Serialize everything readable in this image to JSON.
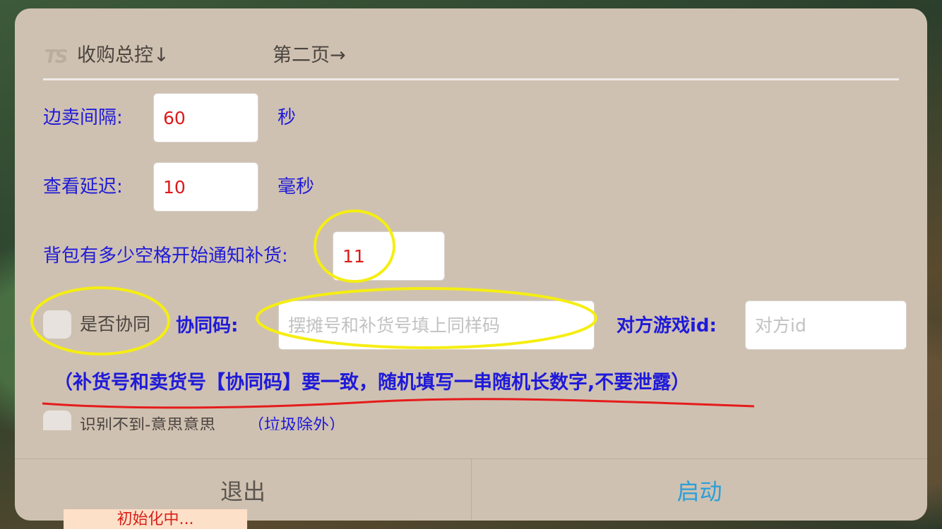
{
  "header": {
    "logo_text": "TS",
    "tab_current": "收购总控↓",
    "tab_next": "第二页→"
  },
  "form": {
    "sell_interval": {
      "label": "边卖间隔:",
      "value": "60",
      "unit": "秒"
    },
    "view_delay": {
      "label": "查看延迟:",
      "value": "10",
      "unit": "毫秒"
    },
    "bag_slots": {
      "label": "背包有多少空格开始通知补货:",
      "value": "11"
    },
    "cooperate": {
      "checkbox_label": "是否协同",
      "code_label": "协同码:",
      "code_placeholder": "摆摊号和补货号填上同样码",
      "peer_label": "对方游戏id:",
      "peer_placeholder": "对方id"
    },
    "notice": "（补货号和卖货号【协同码】要一致，随机填写一串随机长数字,不要泄露）",
    "partial_row": {
      "checkbox_label": "识别不到-意思意思",
      "note": "（垃圾除外）"
    }
  },
  "footer": {
    "exit_label": "退出",
    "start_label": "启动"
  },
  "toast": "初始化中...",
  "colors": {
    "dialog_bg": "#cfc1b1",
    "label_blue": "#1f1ad9",
    "value_red": "#dd1a1a",
    "start_blue": "#2a9fd8",
    "annotation_yellow": "#f5ee12",
    "annotation_red": "#e51b1b"
  }
}
